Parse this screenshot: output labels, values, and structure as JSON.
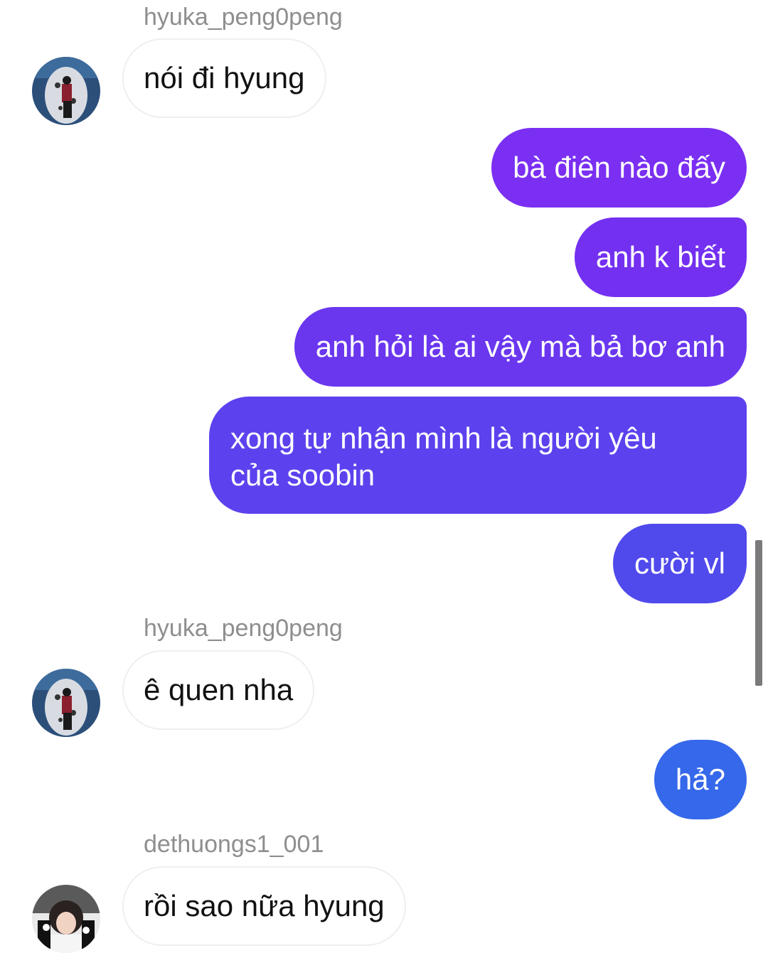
{
  "messages": {
    "m1_sender": "hyuka_peng0peng",
    "m1_text": "nói đi hyung",
    "m2_text": "bà điên nào đấy",
    "m3_text": "anh k biết",
    "m4_text": "anh hỏi là ai vậy mà bả bơ anh",
    "m5_line1": "xong tự nhận mình là người yêu",
    "m5_line2": "của soobin",
    "m6_text": "cười vl",
    "m7_sender": "hyuka_peng0peng",
    "m7_text": "ê quen nha",
    "m8_text": "hả?",
    "m9_sender": "dethuongs1_001",
    "m9_text": "rồi sao nữa hyung"
  },
  "colors": {
    "outgoing_gradient_top": "#7b2ff2",
    "outgoing_gradient_mid": "#5b45ee",
    "outgoing_gradient_bottom": "#3568ea",
    "incoming_border": "#efefef",
    "sender_name": "#8e8e8e"
  },
  "icons": {
    "avatar_hyuka": "avatar-photo",
    "avatar_dethuongs": "avatar-photo"
  }
}
